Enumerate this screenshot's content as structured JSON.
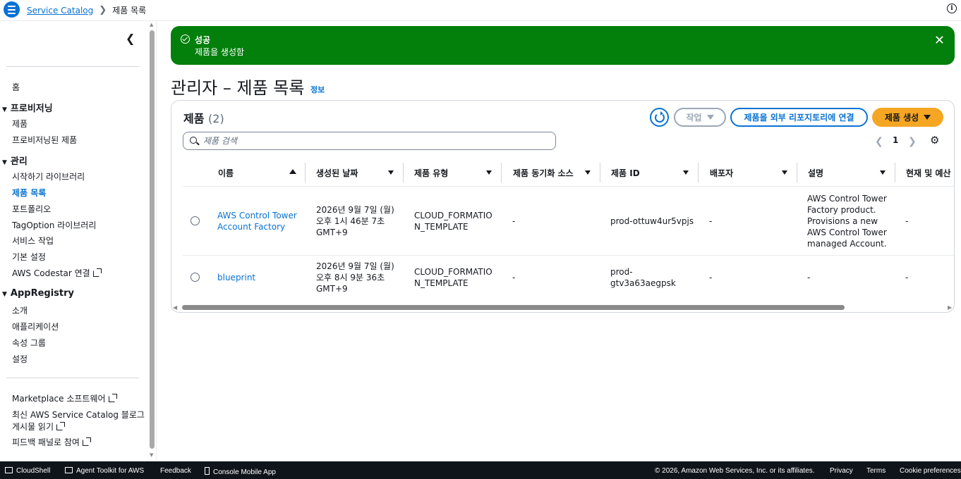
{
  "breadcrumb": {
    "service": "Service Catalog",
    "current": "제품 목록"
  },
  "sidebar": {
    "home": "홈",
    "provisioning": {
      "title": "프로비저닝",
      "items": [
        "제품",
        "프로비저닝된 제품"
      ]
    },
    "admin": {
      "title": "관리",
      "items": [
        "시작하기 라이브러리",
        "제품 목록",
        "포트폴리오",
        "TagOption 라이브러리",
        "서비스 작업",
        "기본 설정",
        "AWS Codestar 연결"
      ]
    },
    "appregistry": {
      "title": "AppRegistry",
      "items": [
        "소개",
        "애플리케이션",
        "속성 그룹",
        "설정"
      ]
    },
    "links": [
      "Marketplace 소프트웨어",
      "최신 AWS Service Catalog 블로그",
      "게시물 읽기",
      "피드백 패널로 참여"
    ]
  },
  "flash": {
    "title": "성공",
    "message": "제품을 생성함",
    "type": "success",
    "color": "#037f0c"
  },
  "page": {
    "title": "관리자 – 제품 목록",
    "info": "정보"
  },
  "products": {
    "title": "제품",
    "count": "(2)",
    "actions_label": "작업",
    "connect_label": "제품을 외부 리포지토리에 연결",
    "create_label": "제품 생성",
    "search_placeholder": "제품 검색",
    "page": "1",
    "columns": [
      "이름",
      "생성된 날짜",
      "제품 유형",
      "제품 동기화 소스",
      "제품 ID",
      "배포자",
      "설명",
      "현재 및 예산"
    ],
    "rows": [
      {
        "name": [
          "AWS Control Tower",
          "Account Factory"
        ],
        "date": [
          "2026년 9월 7일 (월)",
          "오후 1시 46분 7초",
          "GMT+9"
        ],
        "type": [
          "CLOUD_FORMATIO",
          "N_TEMPLATE"
        ],
        "sync": "-",
        "id": [
          "prod-ottuw4ur5vpjs"
        ],
        "distributor": "-",
        "description": [
          "AWS Control Tower",
          "Factory product.",
          "Provisions a new",
          "AWS Control Tower",
          "managed Account."
        ],
        "budget": "-"
      },
      {
        "name": [
          "blueprint"
        ],
        "date": [
          "2026년 9월 7일 (월)",
          "오후 8시 9분 36초",
          "GMT+9"
        ],
        "type": [
          "CLOUD_FORMATIO",
          "N_TEMPLATE"
        ],
        "sync": "-",
        "id": [
          "prod-",
          "gtv3a63aegpsk"
        ],
        "distributor": "-",
        "description": [
          "-"
        ],
        "budget": "-"
      }
    ]
  },
  "footer": {
    "cloudshell": "CloudShell",
    "agent": "Agent Toolkit for AWS",
    "feedback": "Feedback",
    "mobile": "Console Mobile App",
    "copyright": "© 2026, Amazon Web Services, Inc. or its affiliates.",
    "privacy": "Privacy",
    "terms": "Terms",
    "cookies": "Cookie preferences"
  },
  "colors": {
    "link": "#0972d3",
    "primary_button": "#f5a623",
    "success": "#037f0c",
    "footer_bg": "#0f141a"
  }
}
